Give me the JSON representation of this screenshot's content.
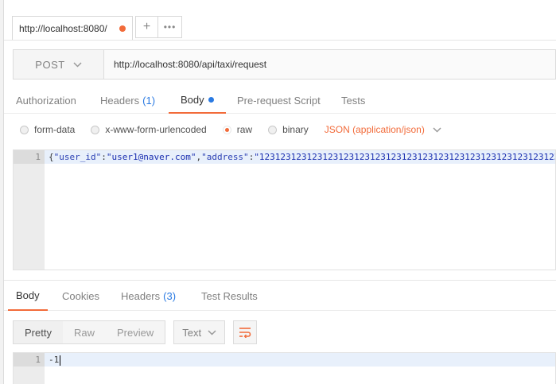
{
  "tabs": {
    "active_tab_label": "http://localhost:8080/",
    "add_symbol": "+",
    "more_symbol": "•••"
  },
  "request": {
    "method": "POST",
    "url": "http://localhost:8080/api/taxi/request"
  },
  "request_tabs": [
    {
      "label": "Authorization"
    },
    {
      "label": "Headers",
      "count": "(1)"
    },
    {
      "label": "Body"
    },
    {
      "label": "Pre-request Script"
    },
    {
      "label": "Tests"
    }
  ],
  "body_options": {
    "form_data": "form-data",
    "urlencoded": "x-www-form-urlencoded",
    "raw": "raw",
    "binary": "binary",
    "content_type": "JSON (application/json)",
    "selected": "raw"
  },
  "request_editor": {
    "line_number": "1",
    "code_parts": {
      "open": "{",
      "key1": "\"user_id\"",
      "colon1": ":",
      "val1": "\"user1@naver.com\"",
      "comma1": ",",
      "key2": "\"address\"",
      "colon2": ":",
      "val2": "\"123123123123123123123123123123123123123123123123123123123123123123123"
    }
  },
  "response_tabs": [
    {
      "label": "Body"
    },
    {
      "label": "Cookies"
    },
    {
      "label": "Headers",
      "count": "(3)"
    },
    {
      "label": "Test Results"
    }
  ],
  "response_toolbar": {
    "pretty": "Pretty",
    "raw": "Raw",
    "preview": "Preview",
    "format": "Text"
  },
  "response_editor": {
    "line_number": "1",
    "content": "-1"
  },
  "colors": {
    "accent": "#f26b3a",
    "link_blue": "#2a7ae2"
  }
}
